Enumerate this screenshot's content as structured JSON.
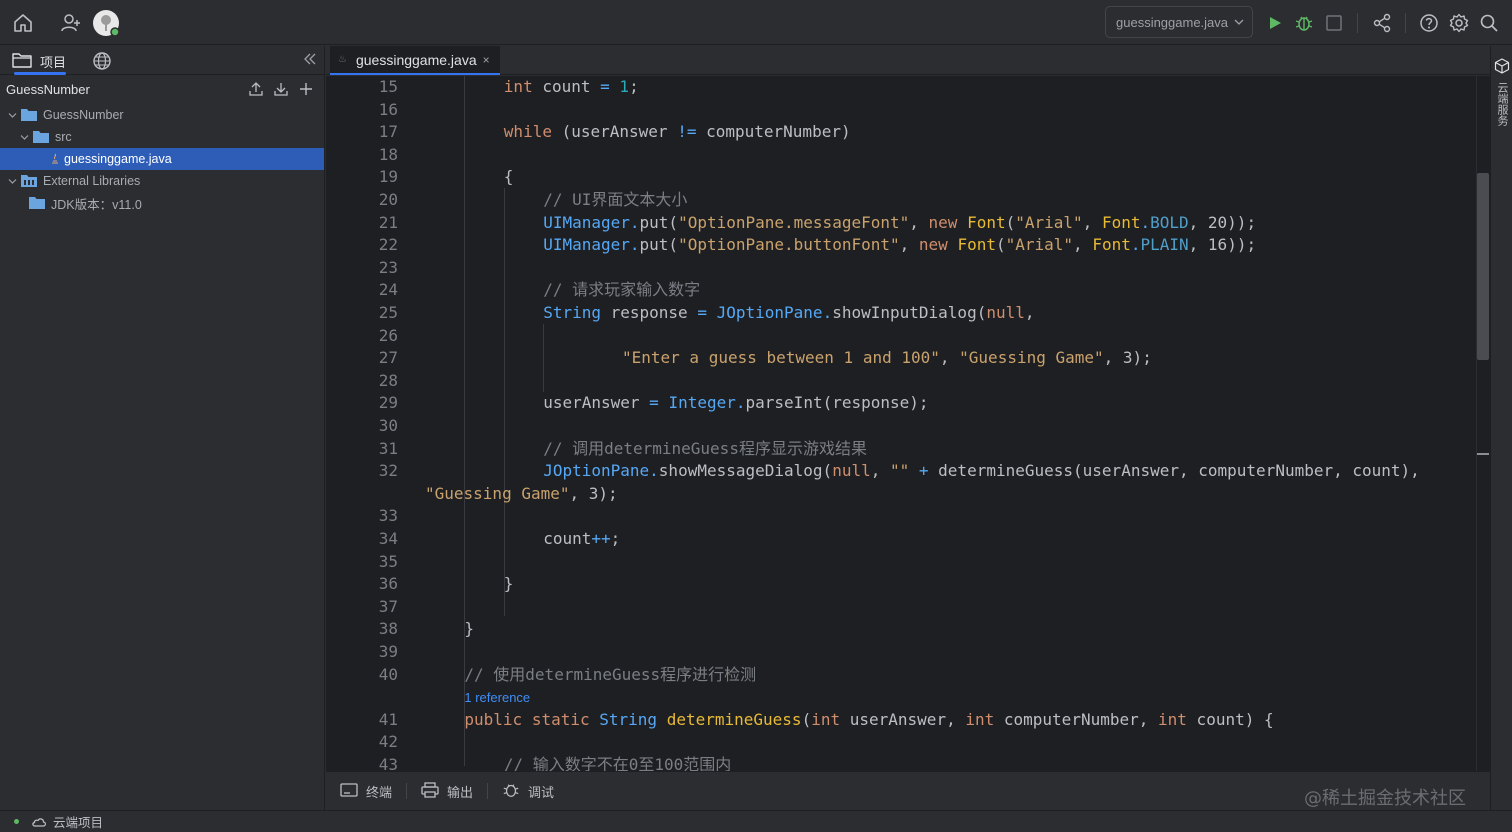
{
  "colors": {
    "accent": "#3574f0",
    "selection": "#2e5db8",
    "run_green": "#5fb865",
    "editor_bg": "#1e1f22",
    "panel_bg": "#2b2d30"
  },
  "toolbar": {
    "file_selector": "guessinggame.java",
    "icons": [
      "home-icon",
      "add-user-icon",
      "avatar",
      "chevron-down-icon",
      "run-icon",
      "debug-icon",
      "stop-icon",
      "share-icon",
      "help-icon",
      "settings-icon",
      "search-icon"
    ]
  },
  "left_panel": {
    "tab_project": "项目",
    "project_name": "GuessNumber",
    "tree": [
      {
        "label": "GuessNumber",
        "icon": "folder-icon"
      },
      {
        "label": "src",
        "icon": "folder-icon"
      },
      {
        "label": "guessinggame.java",
        "icon": "java-file-icon"
      },
      {
        "label": "External Libraries",
        "icon": "library-icon"
      },
      {
        "label": "JDK版本：v11.0",
        "icon": "folder-icon"
      }
    ]
  },
  "editor": {
    "tab_label": "guessinggame.java",
    "tab_close": "×",
    "reference_label": "1 reference",
    "line_numbers": [
      "15",
      "16",
      "17",
      "18",
      "19",
      "20",
      "21",
      "22",
      "23",
      "24",
      "25",
      "26",
      "27",
      "28",
      "29",
      "30",
      "31",
      "32",
      "33",
      "34",
      "35",
      "36",
      "37",
      "38",
      "39",
      "40",
      "41",
      "42",
      "43"
    ]
  },
  "right_strip": {
    "cloud_service": "云端服务"
  },
  "bottom_tools": {
    "terminal": "终端",
    "output": "输出",
    "debug": "调试",
    "watermark": "@稀土掘金技术社区"
  },
  "statusbar": {
    "cloud_project": "云端项目"
  }
}
